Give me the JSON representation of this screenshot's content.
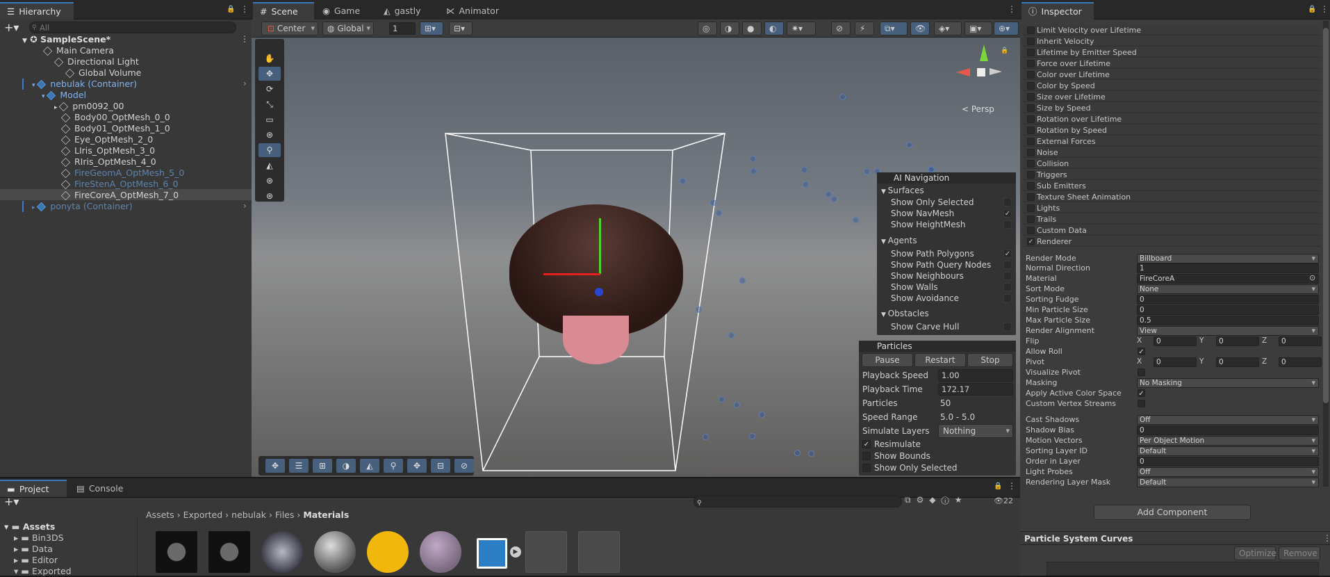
{
  "hierarchy": {
    "tab": "Hierarchy",
    "search_placeholder": "All",
    "scene": "SampleScene*",
    "items": [
      "Main Camera",
      "Directional Light",
      "Global Volume",
      "nebulak (Container)",
      "Model",
      "pm0092_00",
      "Body00_OptMesh_0_0",
      "Body01_OptMesh_1_0",
      "Eye_OptMesh_2_0",
      "LIris_OptMesh_3_0",
      "RIris_OptMesh_4_0",
      "FireGeomA_OptMesh_5_0",
      "FireStenA_OptMesh_6_0",
      "FireCoreA_OptMesh_7_0",
      "ponyta (Container)"
    ]
  },
  "scene_tabs": [
    "Scene",
    "Game",
    "gastly",
    "Animator"
  ],
  "scene_toolbar": {
    "pivot": "Center",
    "space": "Global",
    "snap": "1",
    "persp": "< Persp"
  },
  "ai_nav": {
    "title": "AI Navigation",
    "surfaces": "Surfaces",
    "s1": "Show Only Selected",
    "s2": "Show NavMesh",
    "s3": "Show HeightMesh",
    "agents": "Agents",
    "a1": "Show Path Polygons",
    "a2": "Show Path Query Nodes",
    "a3": "Show Neighbours",
    "a4": "Show Walls",
    "a5": "Show Avoidance",
    "obstacles": "Obstacles",
    "o1": "Show Carve Hull"
  },
  "particles": {
    "title": "Particles",
    "pause": "Pause",
    "restart": "Restart",
    "stop": "Stop",
    "playback_speed_label": "Playback Speed",
    "playback_speed": "1.00",
    "playback_time_label": "Playback Time",
    "playback_time": "172.17",
    "particles_label": "Particles",
    "particles": "50",
    "speed_range_label": "Speed Range",
    "speed_range": "5.0 - 5.0",
    "simulate_layers_label": "Simulate Layers",
    "simulate_layers": "Nothing",
    "resimulate": "Resimulate",
    "show_bounds": "Show Bounds",
    "show_only_selected": "Show Only Selected"
  },
  "project": {
    "tab_project": "Project",
    "tab_console": "Console",
    "count": "22",
    "breadcrumb": [
      "Assets",
      "Exported",
      "nebulak",
      "Files",
      "Materials"
    ],
    "tree": [
      "Assets",
      "Bin3DS",
      "Data",
      "Editor",
      "Exported"
    ]
  },
  "inspector": {
    "tab": "Inspector",
    "modules": [
      "Limit Velocity over Lifetime",
      "Inherit Velocity",
      "Lifetime by Emitter Speed",
      "Force over Lifetime",
      "Color over Lifetime",
      "Color by Speed",
      "Size over Lifetime",
      "Size by Speed",
      "Rotation over Lifetime",
      "Rotation by Speed",
      "External Forces",
      "Noise",
      "Collision",
      "Triggers",
      "Sub Emitters",
      "Texture Sheet Animation",
      "Lights",
      "Trails",
      "Custom Data",
      "Renderer"
    ],
    "props": [
      {
        "label": "Render Mode",
        "value": "Billboard",
        "dd": true
      },
      {
        "label": "Normal Direction",
        "value": "1"
      },
      {
        "label": "Material",
        "value": "FireCoreA"
      },
      {
        "label": "Sort Mode",
        "value": "None",
        "dd": true
      },
      {
        "label": "Sorting Fudge",
        "value": "0"
      },
      {
        "label": "Min Particle Size",
        "value": "0"
      },
      {
        "label": "Max Particle Size",
        "value": "0.5"
      },
      {
        "label": "Render Alignment",
        "value": "View",
        "dd": true
      },
      {
        "label": "Flip",
        "value": ""
      },
      {
        "label": "Allow Roll",
        "value": ""
      },
      {
        "label": "Pivot",
        "value": ""
      },
      {
        "label": "Visualize Pivot",
        "value": ""
      },
      {
        "label": "Masking",
        "value": "No Masking",
        "dd": true
      },
      {
        "label": "Apply Active Color Space",
        "value": ""
      },
      {
        "label": "Custom Vertex Streams",
        "value": ""
      },
      {
        "label": "Cast Shadows",
        "value": "Off",
        "dd": true
      },
      {
        "label": "Shadow Bias",
        "value": "0"
      },
      {
        "label": "Motion Vectors",
        "value": "Per Object Motion",
        "dd": true
      },
      {
        "label": "Sorting Layer ID",
        "value": "Default",
        "dd": true
      },
      {
        "label": "Order in Layer",
        "value": "0"
      },
      {
        "label": "Light Probes",
        "value": "Off",
        "dd": true
      },
      {
        "label": "Rendering Layer Mask",
        "value": "Default",
        "dd": true
      }
    ],
    "xyz": [
      "X",
      "Y",
      "Z"
    ],
    "zero": "0",
    "add_component": "Add Component",
    "curves": "Particle System Curves",
    "optimize": "Optimize",
    "remove": "Remove"
  }
}
